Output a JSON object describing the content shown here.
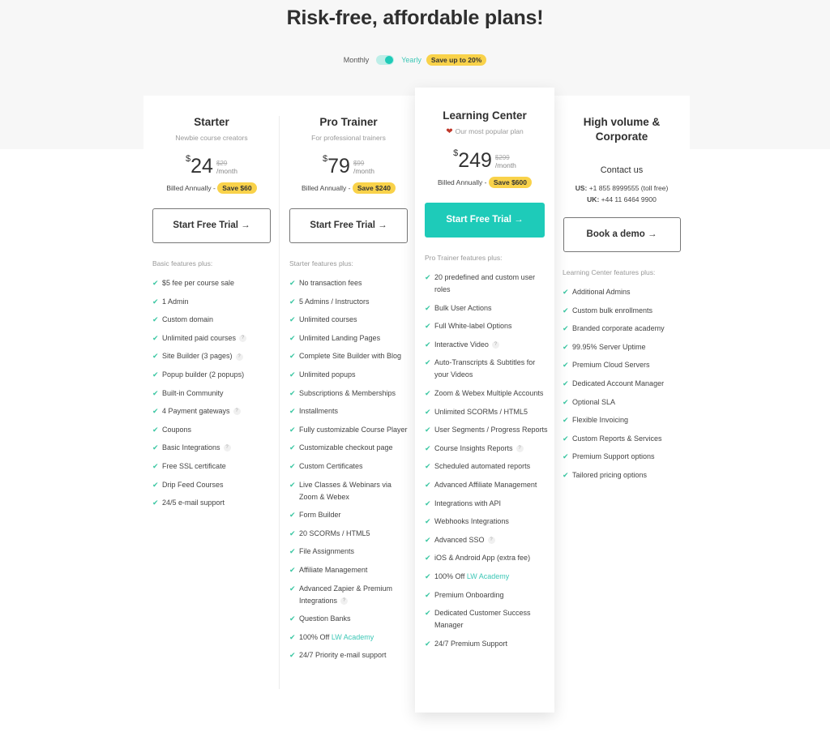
{
  "header": {
    "title": "Risk-free, affordable plans!",
    "toggle": {
      "monthly_label": "Monthly",
      "yearly_label": "Yearly",
      "selected": "Yearly",
      "save_badge": "Save up to 20%"
    }
  },
  "colors": {
    "accent": "#1ecbb9",
    "badge": "#f9d24a",
    "check": "#3cc7a3",
    "heart": "#c0392b"
  },
  "plans": [
    {
      "name": "Starter",
      "subtitle": "Newbie course creators",
      "currency": "$",
      "price": "24",
      "old_price": "$29",
      "per": "/month",
      "billed": "Billed Annually -",
      "save": "Save $60",
      "cta": "Start Free Trial →",
      "features_label": "Basic features plus:",
      "features": [
        {
          "text": "$5 fee per course sale"
        },
        {
          "text": "1 Admin"
        },
        {
          "text": "Custom domain"
        },
        {
          "text": "Unlimited paid courses",
          "help": true
        },
        {
          "text": "Site Builder (3 pages)",
          "help": true
        },
        {
          "text": "Popup builder (2 popups)"
        },
        {
          "text": "Built-in Community"
        },
        {
          "text": "4 Payment gateways",
          "help": true
        },
        {
          "text": "Coupons"
        },
        {
          "text": "Basic Integrations",
          "help": true
        },
        {
          "text": "Free SSL certificate"
        },
        {
          "text": "Drip Feed Courses"
        },
        {
          "text": "24/5 e-mail support"
        }
      ]
    },
    {
      "name": "Pro Trainer",
      "subtitle": "For professional trainers",
      "currency": "$",
      "price": "79",
      "old_price": "$99",
      "per": "/month",
      "billed": "Billed Annually -",
      "save": "Save $240",
      "cta": "Start Free Trial →",
      "features_label": "Starter features plus:",
      "features": [
        {
          "text": "No transaction fees"
        },
        {
          "text": "5 Admins / Instructors"
        },
        {
          "text": "Unlimited courses"
        },
        {
          "text": "Unlimited Landing Pages"
        },
        {
          "text": "Complete Site Builder with Blog"
        },
        {
          "text": "Unlimited popups"
        },
        {
          "text": "Subscriptions & Memberships"
        },
        {
          "text": "Installments"
        },
        {
          "text": "Fully customizable Course Player"
        },
        {
          "text": "Customizable checkout page"
        },
        {
          "text": "Custom Certificates"
        },
        {
          "text": "Live Classes & Webinars via Zoom & Webex"
        },
        {
          "text": "Form Builder"
        },
        {
          "text": "20 SCORMs / HTML5"
        },
        {
          "text": "File Assignments"
        },
        {
          "text": "Affiliate Management"
        },
        {
          "text": "Advanced Zapier & Premium Integrations",
          "help": true
        },
        {
          "text": "Question Banks"
        },
        {
          "text": "100% Off ",
          "link": "LW Academy"
        },
        {
          "text": "24/7 Priority e-mail support"
        }
      ]
    },
    {
      "name": "Learning Center",
      "subtitle": "Our most popular plan",
      "popular_icon": "heart-icon",
      "currency": "$",
      "price": "249",
      "old_price": "$299",
      "per": "/month",
      "billed": "Billed Annually -",
      "save": "Save $600",
      "cta": "Start Free Trial →",
      "features_label": "Pro Trainer features plus:",
      "features": [
        {
          "text": "20 predefined and custom user roles"
        },
        {
          "text": "Bulk User Actions"
        },
        {
          "text": "Full White-label Options"
        },
        {
          "text": "Interactive Video",
          "help": true
        },
        {
          "text": "Auto-Transcripts & Subtitles for your Videos"
        },
        {
          "text": "Zoom & Webex Multiple Accounts"
        },
        {
          "text": "Unlimited SCORMs / HTML5"
        },
        {
          "text": "User Segments / Progress Reports"
        },
        {
          "text": "Course Insights Reports",
          "help": true
        },
        {
          "text": "Scheduled automated reports"
        },
        {
          "text": "Advanced Affiliate Management"
        },
        {
          "text": "Integrations with API"
        },
        {
          "text": "Webhooks Integrations"
        },
        {
          "text": "Advanced SSO",
          "help": true
        },
        {
          "text": "iOS & Android App (extra fee)"
        },
        {
          "text": "100% Off ",
          "link": "LW Academy"
        },
        {
          "text": "Premium Onboarding"
        },
        {
          "text": "Dedicated Customer Success Manager"
        },
        {
          "text": "24/7 Premium Support"
        }
      ]
    },
    {
      "name": "High volume & Corporate",
      "contact": "Contact us",
      "phones": [
        {
          "label": "US:",
          "number": "+1 855 8999555 (toll free)"
        },
        {
          "label": "UK:",
          "number": "+44 11 6464 9900"
        }
      ],
      "cta": "Book a demo →",
      "features_label": "Learning Center features plus:",
      "features": [
        {
          "text": "Additional Admins"
        },
        {
          "text": "Custom bulk enrollments"
        },
        {
          "text": "Branded corporate academy"
        },
        {
          "text": "99.95% Server Uptime"
        },
        {
          "text": "Premium Cloud Servers"
        },
        {
          "text": "Dedicated Account Manager"
        },
        {
          "text": "Optional SLA"
        },
        {
          "text": "Flexible Invoicing"
        },
        {
          "text": "Custom Reports & Services"
        },
        {
          "text": "Premium Support options"
        },
        {
          "text": "Tailored pricing options"
        }
      ]
    }
  ]
}
